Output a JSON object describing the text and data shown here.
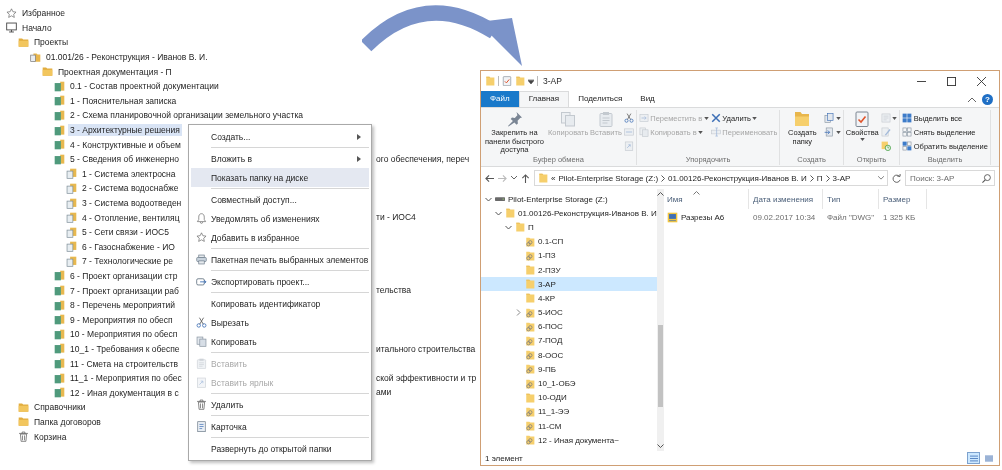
{
  "tree": [
    {
      "label": "Избранное",
      "kind": "star",
      "selected": false
    },
    {
      "label": "Начало",
      "kind": "monitor",
      "selected": false,
      "children": [
        {
          "label": "Проекты",
          "kind": "folder",
          "selected": false,
          "children": [
            {
              "label": "01.001/26 - Реконструкция - Иванов В. И.",
              "kind": "project",
              "selected": false,
              "children": [
                {
                  "label": "Проектная документация - П",
                  "kind": "folder",
                  "selected": false,
                  "children": [
                    {
                      "label": "0.1 - Состав проектной документации",
                      "kind": "section",
                      "selected": false
                    },
                    {
                      "label": "1 - Пояснительная записка",
                      "kind": "section",
                      "selected": false
                    },
                    {
                      "label": "2 - Схема планировочной организации земельного участка",
                      "kind": "section",
                      "selected": false
                    },
                    {
                      "label": "3 - Архитектурные решения",
                      "kind": "section",
                      "selected": true
                    },
                    {
                      "label": "4 - Конструктивные и объем",
                      "kind": "section",
                      "selected": false
                    },
                    {
                      "label": "5 - Сведения об инженерно",
                      "tail": "ого обеспечения, переч",
                      "kind": "section",
                      "selected": false,
                      "children": [
                        {
                          "label": "1 - Система электросна",
                          "kind": "subsection",
                          "selected": false
                        },
                        {
                          "label": "2 - Система водоснабже",
                          "kind": "subsection",
                          "selected": false
                        },
                        {
                          "label": "3 - Система водоотведен",
                          "kind": "subsection",
                          "selected": false
                        },
                        {
                          "label": "4 - Отопление, вентиляц",
                          "tail": "ти - ИОС4",
                          "kind": "subsection",
                          "selected": false
                        },
                        {
                          "label": "5 - Сети связи - ИОС5",
                          "kind": "subsection",
                          "selected": false
                        },
                        {
                          "label": "6 - Газоснабжение - ИО",
                          "kind": "subsection",
                          "selected": false
                        },
                        {
                          "label": "7 - Технологические ре",
                          "kind": "subsection",
                          "selected": false
                        }
                      ]
                    },
                    {
                      "label": "6 - Проект организации стр",
                      "kind": "section",
                      "selected": false
                    },
                    {
                      "label": "7 - Проект организации раб",
                      "tail": "тельства",
                      "kind": "section",
                      "selected": false
                    },
                    {
                      "label": "8 - Перечень мероприятий",
                      "kind": "section",
                      "selected": false
                    },
                    {
                      "label": "9 - Мероприятия по обесп",
                      "kind": "section",
                      "selected": false
                    },
                    {
                      "label": "10 - Мероприятия по обесп",
                      "kind": "section",
                      "selected": false
                    },
                    {
                      "label": "10_1 - Требования к обеспе",
                      "tail": "итального строительства",
                      "kind": "section",
                      "selected": false
                    },
                    {
                      "label": "11 - Смета на строительств",
                      "kind": "section",
                      "selected": false
                    },
                    {
                      "label": "11_1 - Мероприятия по обес",
                      "tail": "ской эффективности и тр",
                      "kind": "section",
                      "selected": false
                    },
                    {
                      "label": "12 - Иная документация в с",
                      "tail": "ами",
                      "kind": "section",
                      "selected": false
                    }
                  ]
                }
              ]
            }
          ]
        },
        {
          "label": "Справочники",
          "kind": "folder",
          "selected": false
        },
        {
          "label": "Папка договоров",
          "kind": "folder",
          "selected": false
        },
        {
          "label": "Корзина",
          "kind": "trash",
          "selected": false
        }
      ]
    }
  ],
  "context_menu": {
    "items": [
      {
        "kind": "submenu",
        "label": "Создать...",
        "disabled": false,
        "selected": false
      },
      {
        "kind": "separator"
      },
      {
        "kind": "submenu",
        "label": "Вложить в",
        "disabled": false,
        "selected": false
      },
      {
        "kind": "plain",
        "label": "Показать папку на диске",
        "disabled": false,
        "selected": true
      },
      {
        "kind": "separator"
      },
      {
        "kind": "plain",
        "label": "Совместный доступ...",
        "disabled": false,
        "selected": false
      },
      {
        "kind": "bell",
        "label": "Уведомлять об изменениях",
        "disabled": false,
        "selected": false
      },
      {
        "kind": "star",
        "label": "Добавить в избранное",
        "disabled": false,
        "selected": false
      },
      {
        "kind": "separator"
      },
      {
        "kind": "printer",
        "label": "Пакетная печать выбранных элементов",
        "disabled": false,
        "selected": false
      },
      {
        "kind": "separator"
      },
      {
        "kind": "export",
        "label": "Экспортировать проект...",
        "disabled": false,
        "selected": false
      },
      {
        "kind": "separator"
      },
      {
        "kind": "plain",
        "label": "Копировать идентификатор",
        "disabled": false,
        "selected": false
      },
      {
        "kind": "cut",
        "label": "Вырезать",
        "disabled": false,
        "selected": false
      },
      {
        "kind": "copy",
        "label": "Копировать",
        "disabled": false,
        "selected": false
      },
      {
        "kind": "separator"
      },
      {
        "kind": "paste",
        "label": "Вставить",
        "disabled": true,
        "selected": false
      },
      {
        "kind": "paste-shortcut",
        "label": "Вставить ярлык",
        "disabled": true,
        "selected": false
      },
      {
        "kind": "separator"
      },
      {
        "kind": "trash",
        "label": "Удалить",
        "disabled": false,
        "selected": false
      },
      {
        "kind": "separator"
      },
      {
        "kind": "card",
        "label": "Карточка",
        "disabled": false,
        "selected": false
      },
      {
        "kind": "separator"
      },
      {
        "kind": "plain",
        "label": "Развернуть до открытой папки",
        "disabled": false,
        "selected": false
      }
    ]
  },
  "explorer": {
    "title": "3-АР",
    "tabs": [
      {
        "label": "Файл",
        "kind": "file",
        "selected": false
      },
      {
        "label": "Главная",
        "kind": "tab",
        "selected": true
      },
      {
        "label": "Поделиться",
        "kind": "tab",
        "selected": false
      },
      {
        "label": "Вид",
        "kind": "tab",
        "selected": false
      }
    ],
    "help": "?",
    "ribbon": [
      {
        "label": "Буфер обмена",
        "columns": [
          [
            {
              "kind": "pin",
              "label": "Закрепить на панели быстрого доступа",
              "disabled": false,
              "dropdown": false
            }
          ],
          [
            {
              "kind": "copy",
              "label": "Копировать",
              "disabled": true,
              "dropdown": false
            }
          ],
          [
            {
              "kind": "paste",
              "label": "Вставить",
              "disabled": true,
              "dropdown": false
            }
          ],
          [
            {
              "kind": "cut",
              "disabled": false,
              "dropdown": false
            },
            {
              "kind": "copy-path",
              "disabled": true,
              "dropdown": false
            },
            {
              "kind": "paste-shortcut",
              "disabled": true,
              "dropdown": false
            }
          ]
        ]
      },
      {
        "label": "Упорядочить",
        "columns": [
          [
            {
              "kind": "move",
              "label": "Переместить в",
              "disabled": true,
              "dropdown": true
            },
            {
              "kind": "copy-to",
              "label": "Копировать в",
              "disabled": true,
              "dropdown": true
            }
          ],
          [
            {
              "kind": "delete",
              "label": "Удалить",
              "disabled": false,
              "dropdown": true
            },
            {
              "kind": "rename",
              "label": "Переименовать",
              "disabled": true,
              "dropdown": false
            }
          ]
        ]
      },
      {
        "label": "Создать",
        "columns": [
          [
            {
              "kind": "new-folder",
              "label": "Создать папку",
              "disabled": false,
              "dropdown": false
            }
          ],
          [
            {
              "kind": "new-item",
              "disabled": false,
              "dropdown": true
            },
            {
              "kind": "easy-access",
              "disabled": false,
              "dropdown": true
            }
          ]
        ]
      },
      {
        "label": "Открыть",
        "columns": [
          [
            {
              "kind": "properties",
              "label": "Свойства",
              "disabled": false,
              "dropdown": true
            }
          ],
          [
            {
              "kind": "open",
              "disabled": true,
              "dropdown": true
            },
            {
              "kind": "edit",
              "disabled": true,
              "dropdown": false
            },
            {
              "kind": "history",
              "disabled": false,
              "dropdown": false
            }
          ]
        ]
      },
      {
        "label": "Выделить",
        "columns": [
          [
            {
              "kind": "select-all",
              "label": "Выделить все",
              "disabled": false,
              "dropdown": false
            },
            {
              "kind": "select-none",
              "label": "Снять выделение",
              "disabled": false,
              "dropdown": false
            },
            {
              "kind": "invert",
              "label": "Обратить выделение",
              "disabled": false,
              "dropdown": false
            }
          ]
        ]
      }
    ],
    "address": {
      "overflow": "«",
      "crumbs": [
        "Pilot-Enterprise Storage (Z:)",
        "01.00126-Реконструкция-Иванов В. И",
        "П",
        "3-АР"
      ]
    },
    "search": {
      "placeholder": "Поиск: 3-АР"
    },
    "nav": [
      {
        "label": "Pilot-Enterprise Storage (Z:)",
        "kind": "drive",
        "expanded": true,
        "selected": false,
        "children": [
          {
            "label": "01.00126-Реконструкция-Иванов В. И",
            "kind": "folder",
            "linked": false,
            "expanded": true,
            "selected": false,
            "children": [
              {
                "label": "П",
                "kind": "folder",
                "linked": false,
                "expanded": true,
                "selected": false,
                "children": [
                  {
                    "label": "0.1-СП",
                    "kind": "folder",
                    "linked": true,
                    "selected": false
                  },
                  {
                    "label": "1-ПЗ",
                    "kind": "folder",
                    "linked": true,
                    "selected": false
                  },
                  {
                    "label": "2-ПЗУ",
                    "kind": "folder",
                    "linked": false,
                    "selected": false
                  },
                  {
                    "label": "3-АР",
                    "kind": "folder",
                    "linked": false,
                    "selected": true
                  },
                  {
                    "label": "4-КР",
                    "kind": "folder",
                    "linked": false,
                    "selected": false
                  },
                  {
                    "label": "5-ИОС",
                    "kind": "folder",
                    "linked": true,
                    "expanded": false,
                    "selected": false
                  },
                  {
                    "label": "6-ПОС",
                    "kind": "folder",
                    "linked": true,
                    "selected": false
                  },
                  {
                    "label": "7-ПОД",
                    "kind": "folder",
                    "linked": true,
                    "selected": false
                  },
                  {
                    "label": "8-ООС",
                    "kind": "folder",
                    "linked": true,
                    "selected": false
                  },
                  {
                    "label": "9-ПБ",
                    "kind": "folder",
                    "linked": true,
                    "selected": false
                  },
                  {
                    "label": "10_1-ОБЭ",
                    "kind": "folder",
                    "linked": true,
                    "selected": false
                  },
                  {
                    "label": "10-ОДИ",
                    "kind": "folder",
                    "linked": false,
                    "selected": false
                  },
                  {
                    "label": "11_1-ЭЭ",
                    "kind": "folder",
                    "linked": true,
                    "selected": false
                  },
                  {
                    "label": "11-СМ",
                    "kind": "folder",
                    "linked": true,
                    "selected": false
                  },
                  {
                    "label": "12 - Иная документа~",
                    "kind": "folder",
                    "linked": true,
                    "selected": false
                  }
                ]
              }
            ]
          }
        ]
      }
    ],
    "columns": [
      {
        "label": "Имя",
        "sorted": true
      },
      {
        "label": "Дата изменения",
        "sorted": false
      },
      {
        "label": "Тип",
        "sorted": false
      },
      {
        "label": "Размер",
        "sorted": false
      }
    ],
    "files": [
      {
        "name": "Разрезы А6",
        "date": "09.02.2017 10:34",
        "type": "Файл \"DWG\"",
        "size": "1 325 КБ"
      }
    ],
    "status": "1 элемент",
    "views": [
      {
        "kind": "details",
        "selected": true
      },
      {
        "kind": "tiles",
        "selected": false
      }
    ]
  }
}
